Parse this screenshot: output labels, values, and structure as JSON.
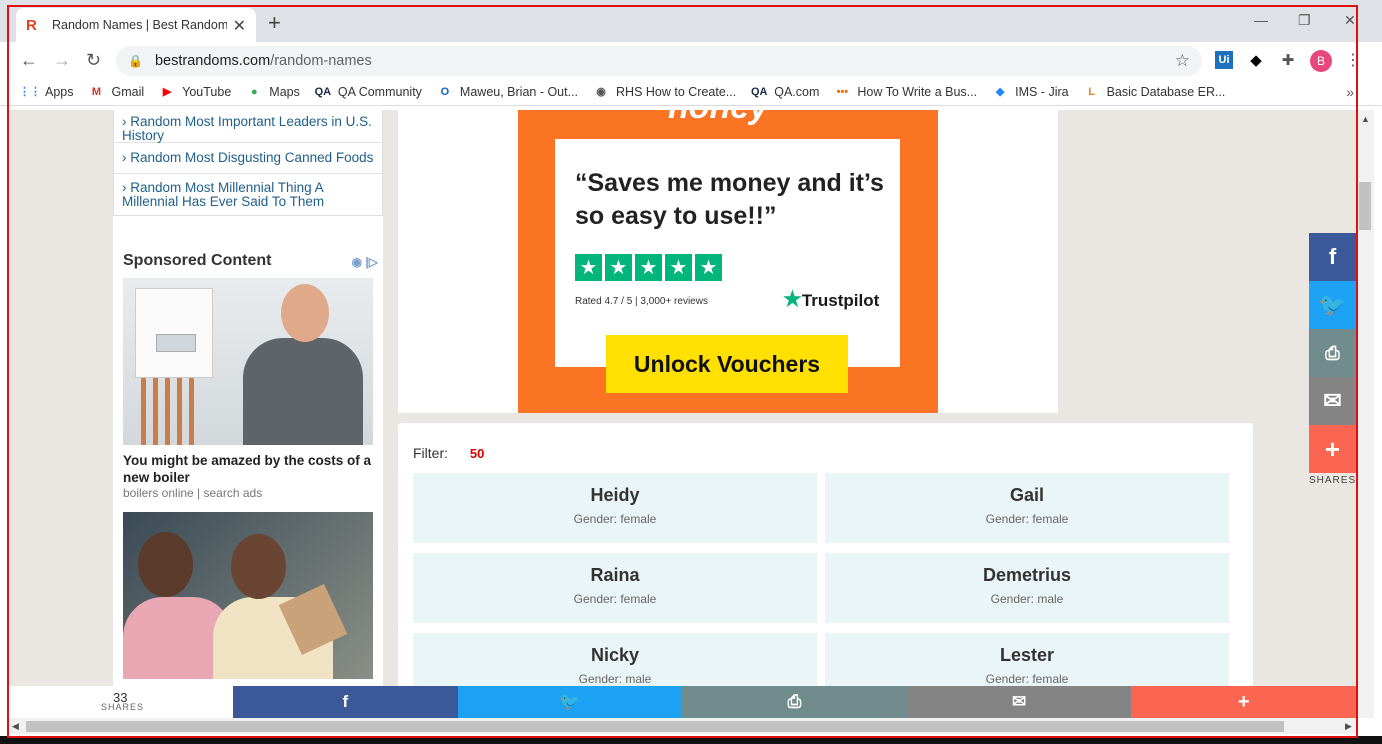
{
  "browser": {
    "tab_favicon": "R",
    "tab_title": "Random Names | Best Random T",
    "tab_close": "✕",
    "new_tab": "+",
    "url_domain": "bestrandoms.com",
    "url_path": "/random-names",
    "profile_initial": "B",
    "extension_ui": "Ui"
  },
  "bookmarks": [
    {
      "label": "Apps",
      "icon": "apps-grid-icon",
      "color": "#4285f4"
    },
    {
      "label": "Gmail",
      "icon": "gmail-icon",
      "color": "#d93025"
    },
    {
      "label": "YouTube",
      "icon": "youtube-icon",
      "color": "#ff0000"
    },
    {
      "label": "Maps",
      "icon": "maps-icon",
      "color": "#34a853"
    },
    {
      "label": "QA Community",
      "icon": "qa-icon",
      "color": "#1a2a4a"
    },
    {
      "label": "Maweu, Brian - Out...",
      "icon": "outlook-icon",
      "color": "#0a64c8"
    },
    {
      "label": "RHS How to Create...",
      "icon": "globe-icon",
      "color": "#555555"
    },
    {
      "label": "QA.com",
      "icon": "qa-icon",
      "color": "#1a2a4a"
    },
    {
      "label": "How To Write a Bus...",
      "icon": "dots-icon",
      "color": "#e8710a"
    },
    {
      "label": "IMS - Jira",
      "icon": "jira-icon",
      "color": "#2684ff"
    },
    {
      "label": "Basic Database ER...",
      "icon": "lucidchart-icon",
      "color": "#f07c1b"
    }
  ],
  "sidebar": {
    "related": [
      "› Random Most Important Leaders in U.S. History",
      "› Random Most Disgusting Canned Foods",
      "› Random Most Millennial Thing A Millennial Has Ever Said To Them"
    ],
    "sponsored_heading": "Sponsored Content",
    "sponsored_title": "You might be amazed by the costs of a new boiler",
    "sponsored_source": "boilers online | search ads"
  },
  "ad": {
    "quote": "“Saves me money and it’s so easy to use!!”",
    "rating": "Rated 4.7 / 5 | 3,000+ reviews",
    "trustpilot": "Trustpilot",
    "button": "Unlock Vouchers"
  },
  "names": {
    "filter_label": "Filter:",
    "filter_count": "50",
    "items": [
      {
        "name": "Heidy",
        "gender": "Gender: female"
      },
      {
        "name": "Gail",
        "gender": "Gender: female"
      },
      {
        "name": "Raina",
        "gender": "Gender: female"
      },
      {
        "name": "Demetrius",
        "gender": "Gender: male"
      },
      {
        "name": "Nicky",
        "gender": "Gender: male"
      },
      {
        "name": "Lester",
        "gender": "Gender: female"
      }
    ]
  },
  "social": {
    "shares_count": "33",
    "shares_label": "SHARES",
    "colors": {
      "facebook": "#3b5998",
      "twitter": "#1da1f2",
      "print": "#718c8c",
      "email": "#848484",
      "more": "#fa6651"
    }
  }
}
